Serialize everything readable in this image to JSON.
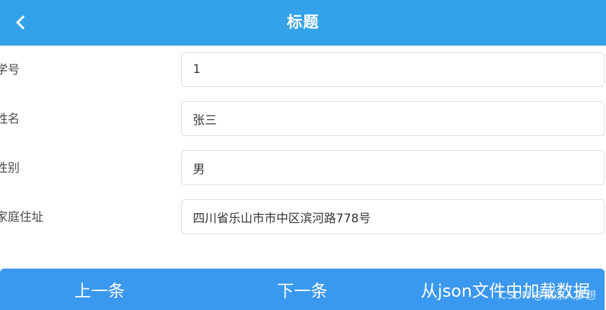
{
  "header": {
    "title": "标题",
    "back_icon": "chevron-left-icon"
  },
  "form": {
    "student_id": {
      "label": "学号",
      "value": "1"
    },
    "name": {
      "label": "姓名",
      "value": "张三"
    },
    "gender": {
      "label": "性别",
      "value": "男"
    },
    "address": {
      "label": "家庭住址",
      "value": "四川省乐山市市中区滨河路778号"
    }
  },
  "actions": {
    "prev_label": "上一条",
    "next_label": "下一条",
    "load_json_label": "从json文件中加载数据"
  },
  "watermark": "CSDN @果冻人梦想",
  "colors": {
    "header_bg": "#33a2e8",
    "bar_bg": "#3a98ee",
    "field_border": "#dcdcdc"
  }
}
